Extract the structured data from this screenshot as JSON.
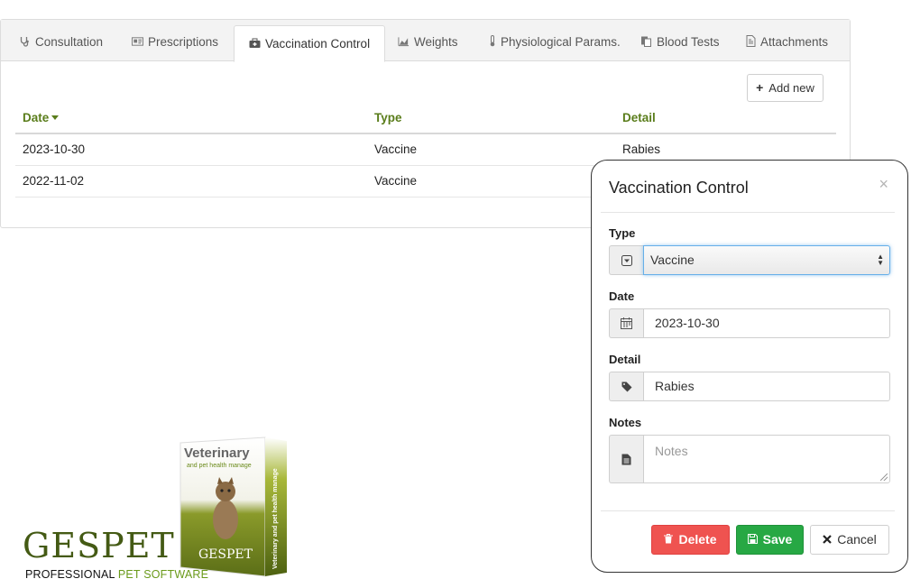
{
  "tabs": [
    {
      "label": "Consultation",
      "icon": "stethoscope-icon"
    },
    {
      "label": "Prescriptions",
      "icon": "prescription-icon"
    },
    {
      "label": "Vaccination Control",
      "icon": "medkit-icon",
      "active": true
    },
    {
      "label": "Weights",
      "icon": "area-chart-icon"
    },
    {
      "label": "Physiological Params.",
      "icon": "thermometer-icon"
    },
    {
      "label": "Blood Tests",
      "icon": "copy-icon"
    },
    {
      "label": "Attachments",
      "icon": "file-icon"
    }
  ],
  "toolbar": {
    "add_new_label": "Add new"
  },
  "table": {
    "columns": [
      "Date",
      "Type",
      "Detail"
    ],
    "sort_column": "Date",
    "rows": [
      [
        "2023-10-30",
        "Vaccine",
        "Rabies"
      ],
      [
        "2022-11-02",
        "Vaccine",
        ""
      ]
    ]
  },
  "modal": {
    "title": "Vaccination Control",
    "close_glyph": "×",
    "fields": {
      "type": {
        "label": "Type",
        "value": "Vaccine"
      },
      "date": {
        "label": "Date",
        "value": "2023-10-30"
      },
      "detail": {
        "label": "Detail",
        "value": "Rabies"
      },
      "notes": {
        "label": "Notes",
        "placeholder": "Notes"
      }
    },
    "buttons": {
      "delete": "Delete",
      "save": "Save",
      "cancel": "Cancel"
    }
  },
  "product_box": {
    "title": "Veterinary",
    "subtitle": "and pet health manage",
    "spine": "Veterinary and pet health manage",
    "brand": "GESPET"
  },
  "branding": {
    "logo": "GESPET",
    "tagline_part1": "PROFESSIONAL ",
    "tagline_part2": "PET SOFTWARE"
  },
  "colors": {
    "accent_green": "#5a7d1b",
    "delete_red": "#ef5350",
    "save_green": "#27a844",
    "focus_blue": "#66afe9"
  }
}
